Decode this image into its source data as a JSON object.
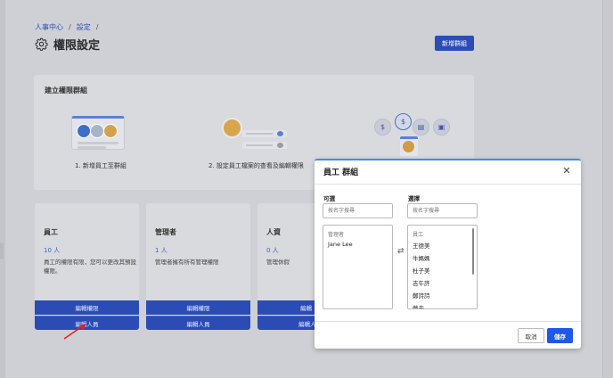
{
  "breadcrumb": {
    "root": "人事中心",
    "sep1": "/",
    "current": "設定",
    "sep2": "/"
  },
  "page": {
    "title": "權限設定",
    "new_group_label": "新增群組"
  },
  "create_group": {
    "title": "建立權限群組",
    "step1": "1. 新增員工至群組",
    "step2": "2. 設定員工檔案的查看及編輯權限"
  },
  "roles": [
    {
      "name": "員工",
      "count": "10 人",
      "desc": "員工的權限有限，您可以更改其預設權限。",
      "edit_perm": "編輯權限",
      "edit_people": "編輯人員"
    },
    {
      "name": "管理者",
      "count": "1 人",
      "desc": "管理者擁有所有管理權限",
      "edit_perm": "編輯權限",
      "edit_people": "編輯人員"
    },
    {
      "name": "人資",
      "count": "0 人",
      "desc": "管理休假",
      "edit_perm": "編輯",
      "edit_people": "編輯人"
    }
  ],
  "modal": {
    "title": "員工 群組",
    "available_label": "可選",
    "selected_label": "選擇",
    "search_placeholder": "按名字搜尋",
    "available_group": "管理者",
    "available_items": [
      "Jane Lee"
    ],
    "selected_group": "員工",
    "selected_items": [
      "王德美",
      "牛媽媽",
      "杜子美",
      "吉午許",
      "鄭詩詩",
      "戴夫"
    ],
    "cancel_label": "取消",
    "save_label": "儲存"
  },
  "icons": {
    "illus3": [
      "$",
      "$",
      "▤",
      "▣"
    ]
  },
  "colors": {
    "accent": "#2c4db6",
    "save": "#1f57e8",
    "modal_top": "#3d8fe0",
    "arrow": "#e02020"
  }
}
